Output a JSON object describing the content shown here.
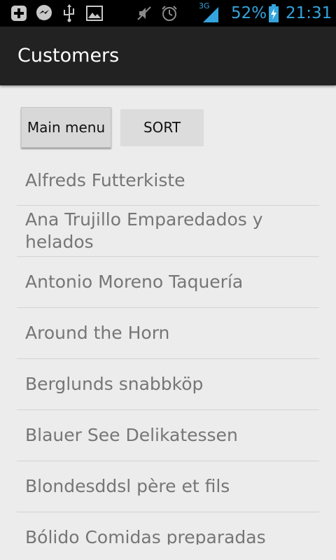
{
  "status_bar": {
    "icons": [
      "add-box-icon",
      "messenger-icon",
      "usb-icon",
      "image-icon",
      "mute-icon",
      "alarm-icon",
      "signal-3g-icon",
      "battery-charging-icon"
    ],
    "network": "3G",
    "battery": "52%",
    "time": "21:31"
  },
  "action_bar": {
    "title": "Customers"
  },
  "buttons": {
    "main_menu": "Main menu",
    "sort": "SORT"
  },
  "customers": [
    "Alfreds Futterkiste",
    "Ana Trujillo Emparedados y helados",
    "Antonio Moreno Taquería",
    "Around the Horn",
    "Berglunds snabbköp",
    "Blauer See Delikatessen",
    "Blondesddsl père et fils",
    "Bólido Comidas preparadas"
  ],
  "colors": {
    "status_bar_bg": "#000000",
    "status_text": "#35a4dd",
    "action_bar_bg": "#222222",
    "page_bg": "#ececec",
    "list_text": "#767676",
    "divider": "#d3d3d3"
  }
}
